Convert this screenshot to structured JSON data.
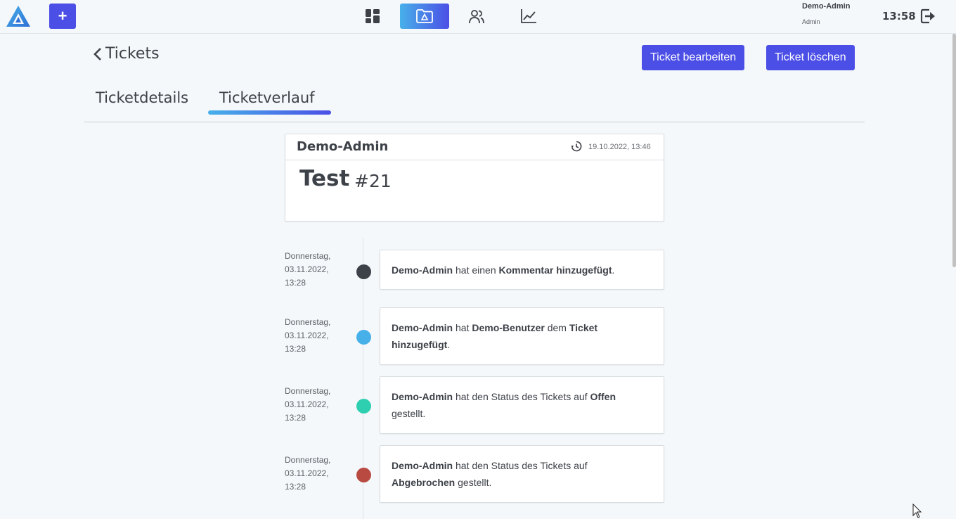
{
  "header": {
    "add_label": "+",
    "user_name": "Demo-Admin",
    "user_role": "Admin",
    "clock": "13:58"
  },
  "page": {
    "back_title": "Tickets",
    "edit_button": "Ticket bearbeiten",
    "delete_button": "Ticket löschen",
    "tabs": [
      {
        "label": "Ticketdetails",
        "active": false
      },
      {
        "label": "Ticketverlauf",
        "active": true
      }
    ]
  },
  "ticket": {
    "author": "Demo-Admin",
    "timestamp": "19.10.2022, 13:46",
    "title": "Test",
    "number": "#21"
  },
  "timeline": [
    {
      "day": "Donnerstag,",
      "date": "03.11.2022,",
      "time": "13:28",
      "color": "#3d4148",
      "parts": [
        [
          "Demo-Admin",
          true
        ],
        [
          " hat einen ",
          false
        ],
        [
          "Kommentar hinzugefügt",
          true
        ],
        [
          ".",
          false
        ]
      ]
    },
    {
      "day": "Donnerstag,",
      "date": "03.11.2022,",
      "time": "13:28",
      "color": "#47b0e9",
      "parts": [
        [
          "Demo-Admin",
          true
        ],
        [
          " hat ",
          false
        ],
        [
          "Demo-Benutzer",
          true
        ],
        [
          " dem ",
          false
        ],
        [
          "Ticket hinzugefügt",
          true
        ],
        [
          ".",
          false
        ]
      ]
    },
    {
      "day": "Donnerstag,",
      "date": "03.11.2022,",
      "time": "13:28",
      "color": "#2ecfb0",
      "parts": [
        [
          "Demo-Admin",
          true
        ],
        [
          " hat den Status des Tickets auf ",
          false
        ],
        [
          "Offen",
          true
        ],
        [
          " gestellt.",
          false
        ]
      ]
    },
    {
      "day": "Donnerstag,",
      "date": "03.11.2022,",
      "time": "13:28",
      "color": "#b84a42",
      "parts": [
        [
          "Demo-Admin",
          true
        ],
        [
          " hat den Status des Tickets auf ",
          false
        ],
        [
          "Abgebrochen",
          true
        ],
        [
          " gestellt.",
          false
        ]
      ]
    }
  ],
  "colors": {
    "accent": "#4b4fe6",
    "accent_light": "#47b0e9",
    "background": "#f5f8fa"
  }
}
